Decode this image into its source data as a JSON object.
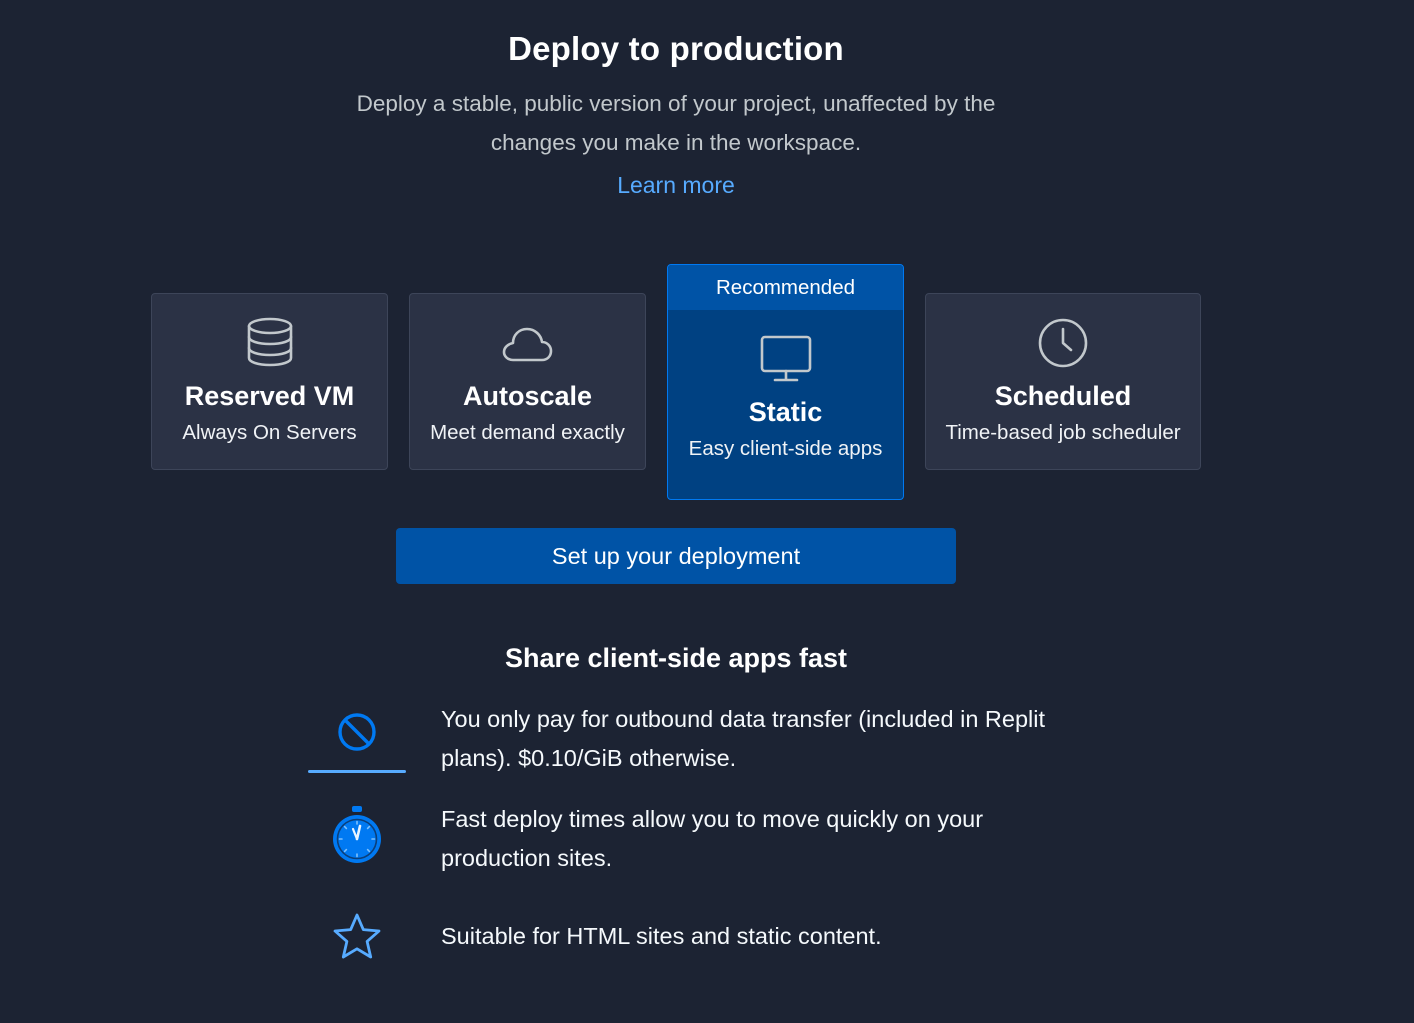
{
  "header": {
    "title": "Deploy to production",
    "subtitle": "Deploy a stable, public version of your project, unaffected by the changes you make in the workspace.",
    "learn_more": "Learn more"
  },
  "deployment_types": [
    {
      "title": "Reserved VM",
      "description": "Always On Servers",
      "icon": "database-icon",
      "selected": false
    },
    {
      "title": "Autoscale",
      "description": "Meet demand exactly",
      "icon": "cloud-icon",
      "selected": false
    },
    {
      "title": "Static",
      "description": "Easy client-side apps",
      "icon": "monitor-icon",
      "selected": true,
      "badge": "Recommended"
    },
    {
      "title": "Scheduled",
      "description": "Time-based job scheduler",
      "icon": "clock-icon",
      "selected": false
    }
  ],
  "setup_button": "Set up your deployment",
  "features": {
    "title": "Share client-side apps fast",
    "items": [
      {
        "icon": "no-symbol-icon",
        "text": "You only pay for outbound data transfer (included in Replit plans). $0.10/GiB otherwise."
      },
      {
        "icon": "stopwatch-icon",
        "text": "Fast deploy times allow you to move quickly on your production sites."
      },
      {
        "icon": "star-icon",
        "text": "Suitable for HTML sites and static content."
      }
    ]
  },
  "colors": {
    "background": "#1c2333",
    "card": "#2b3245",
    "selected_card": "#004182",
    "selected_border": "#0079f2",
    "primary_button": "#0053a6",
    "link": "#57abff"
  }
}
